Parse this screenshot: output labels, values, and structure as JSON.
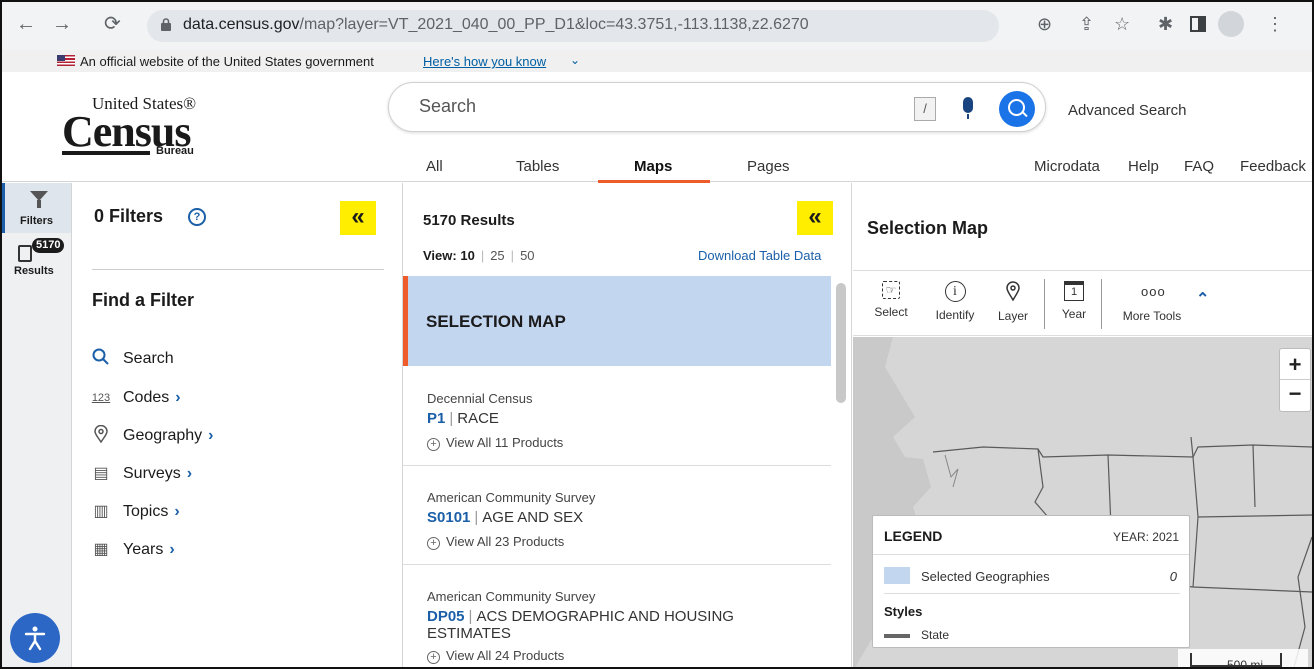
{
  "browser": {
    "url_domain": "data.census.gov",
    "url_path": "/map?layer=VT_2021_040_00_PP_D1&loc=43.3751,-113.1138,z2.6270"
  },
  "gov_banner": {
    "text": "An official website of the United States government",
    "link": "Here's how you know"
  },
  "logo": {
    "line1": "United States®",
    "line2": "Census",
    "line3": "Bureau"
  },
  "search": {
    "placeholder": "Search",
    "shortcut_key": "/",
    "advanced_label": "Advanced Search"
  },
  "nav": {
    "tabs": [
      "All",
      "Tables",
      "Maps",
      "Pages"
    ],
    "active_tab": "Maps",
    "links": [
      "Microdata",
      "Help",
      "FAQ",
      "Feedback"
    ]
  },
  "rail": {
    "filters_label": "Filters",
    "results_badge": "5170",
    "results_label": "Results"
  },
  "filter_panel": {
    "title": "0 Filters",
    "help_symbol": "?",
    "collapse_symbol": "«",
    "find_title": "Find a Filter",
    "items": [
      {
        "label": "Search",
        "icon": "search-icon",
        "glyph": "🔍",
        "chevron": ""
      },
      {
        "label": "Codes",
        "icon": "codes-icon",
        "glyph": "123",
        "chevron": "›"
      },
      {
        "label": "Geography",
        "icon": "location-pin-icon",
        "glyph": "⌾",
        "chevron": "›"
      },
      {
        "label": "Surveys",
        "icon": "survey-icon",
        "glyph": "▤",
        "chevron": "›"
      },
      {
        "label": "Topics",
        "icon": "topics-icon",
        "glyph": "▥",
        "chevron": "›"
      },
      {
        "label": "Years",
        "icon": "calendar-icon",
        "glyph": "▦",
        "chevron": "›"
      }
    ]
  },
  "results_panel": {
    "count_label": "5170 Results",
    "view_label": "View:",
    "view_options": [
      "10",
      "25",
      "50"
    ],
    "view_selected": "10",
    "download_label": "Download Table Data",
    "selection_map_card": "SELECTION MAP",
    "cards": [
      {
        "survey": "Decennial Census",
        "id": "P1",
        "title": "RACE",
        "view_all": "View All 11 Products"
      },
      {
        "survey": "American Community Survey",
        "id": "S0101",
        "title": "AGE AND SEX",
        "view_all": "View All 23 Products"
      },
      {
        "survey": "American Community Survey",
        "id": "DP05",
        "title": "ACS DEMOGRAPHIC AND HOUSING ESTIMATES",
        "view_all": "View All 24 Products"
      }
    ]
  },
  "map_panel": {
    "title": "Selection Map",
    "tools": [
      "Select",
      "Identify",
      "Layer",
      "Year",
      "More Tools"
    ],
    "year_icon_digit": "1",
    "more_tools_glyph": "ooo",
    "zoom_in": "+",
    "zoom_out": "−",
    "legend": {
      "title": "LEGEND",
      "year": "YEAR: 2021",
      "selected_label": "Selected Geographies",
      "selected_count": "0",
      "styles_label": "Styles",
      "state_label": "State"
    },
    "scale_label": "500 mi"
  },
  "colors": {
    "accent_orange": "#ee5c2c",
    "link_blue": "#1b5fa8",
    "highlight_yellow": "#ffee00",
    "selection_blue": "#c3d6f0"
  }
}
